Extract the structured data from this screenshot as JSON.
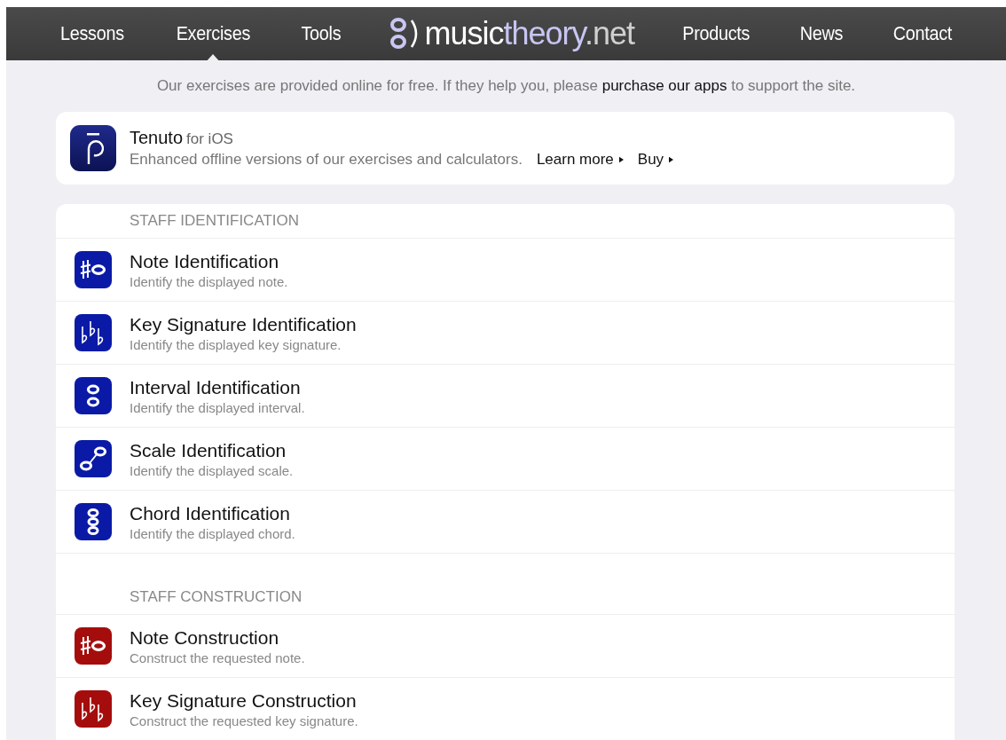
{
  "nav": {
    "items_left": [
      {
        "label": "Lessons",
        "selected": false
      },
      {
        "label": "Exercises",
        "selected": true
      },
      {
        "label": "Tools",
        "selected": false
      }
    ],
    "logo": {
      "parts": [
        "music",
        "theory",
        ".net"
      ]
    },
    "items_right": [
      {
        "label": "Products",
        "selected": false
      },
      {
        "label": "News",
        "selected": false
      },
      {
        "label": "Contact",
        "selected": false
      }
    ]
  },
  "intro": {
    "text": "Our exercises are provided online for free. If they help you, please",
    "link": "purchase our apps",
    "after": "to support the site."
  },
  "promo": {
    "name": "Tenuto",
    "platform": "for iOS",
    "description": "Enhanced offline versions of our exercises and calculators.",
    "links": [
      "Learn more",
      "Buy"
    ]
  },
  "sections": [
    {
      "title": "STAFF IDENTIFICATION",
      "color": "#0a1aa6",
      "items": [
        {
          "kind": "note",
          "title": "Note Identification",
          "subtitle": "Identify the displayed note."
        },
        {
          "kind": "keysig",
          "title": "Key Signature Identification",
          "subtitle": "Identify the displayed key signature."
        },
        {
          "kind": "interval",
          "title": "Interval Identification",
          "subtitle": "Identify the displayed interval."
        },
        {
          "kind": "scale",
          "title": "Scale Identification",
          "subtitle": "Identify the displayed scale."
        },
        {
          "kind": "chord",
          "title": "Chord Identification",
          "subtitle": "Identify the displayed chord."
        }
      ]
    },
    {
      "title": "STAFF CONSTRUCTION",
      "color": "#a50d0d",
      "items": [
        {
          "kind": "note",
          "title": "Note Construction",
          "subtitle": "Construct the requested note."
        },
        {
          "kind": "keysig",
          "title": "Key Signature Construction",
          "subtitle": "Construct the requested key signature."
        }
      ]
    }
  ]
}
